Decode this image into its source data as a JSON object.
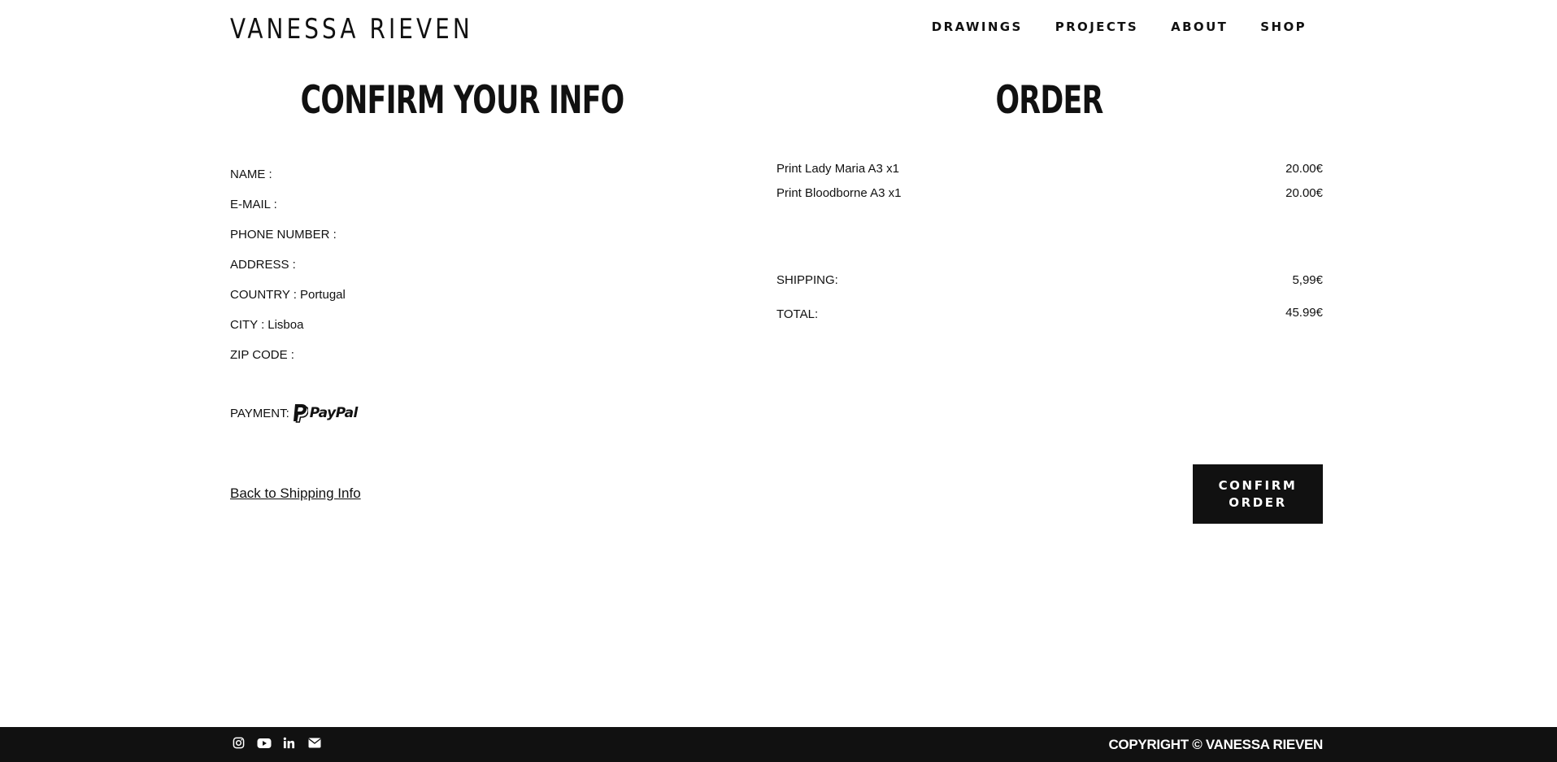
{
  "header": {
    "logo": "VANESSA RIEVEN",
    "nav": [
      "DRAWINGS",
      "PROJECTS",
      "ABOUT",
      "SHOP"
    ]
  },
  "info": {
    "heading": "CONFIRM YOUR INFO",
    "fields": [
      {
        "label": "NAME :",
        "value": ""
      },
      {
        "label": "E-MAIL :",
        "value": ""
      },
      {
        "label": "PHONE NUMBER :",
        "value": ""
      },
      {
        "label": "ADDRESS :",
        "value": ""
      },
      {
        "label": "COUNTRY :",
        "value": "Portugal"
      },
      {
        "label": "CITY :",
        "value": "Lisboa"
      },
      {
        "label": "ZIP CODE :",
        "value": ""
      }
    ],
    "payment_label": "PAYMENT:",
    "payment_method": "PayPal",
    "back_link": "Back to Shipping Info"
  },
  "order": {
    "heading": "ORDER",
    "items": [
      {
        "name": "Print Lady Maria A3 x1",
        "price": "20.00€"
      },
      {
        "name": "Print Bloodborne A3 x1",
        "price": "20.00€"
      }
    ],
    "shipping_label": "SHIPPING:",
    "shipping_value": "5,99€",
    "total_label": "TOTAL:",
    "total_value": "45.99€",
    "confirm_line1": "CONFIRM",
    "confirm_line2": "ORDER"
  },
  "footer": {
    "icons": [
      "instagram-icon",
      "youtube-icon",
      "linkedin-icon",
      "mail-icon"
    ],
    "copyright": "COPYRIGHT © VANESSA RIEVEN"
  },
  "colors": {
    "text": "#111111",
    "background": "#ffffff",
    "footer": "#111111",
    "button": "#111111"
  }
}
